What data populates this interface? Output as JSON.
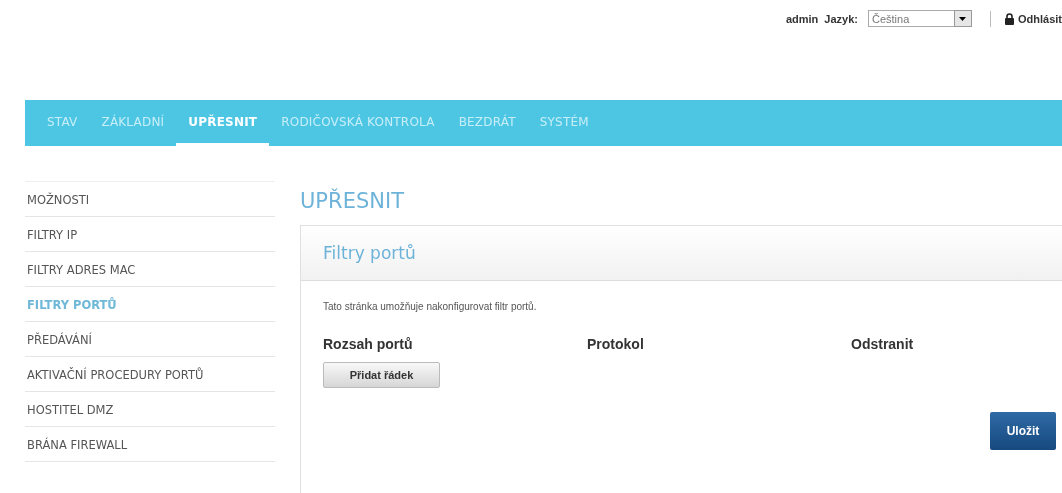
{
  "header": {
    "user": "admin",
    "language_label": "Jazyk:",
    "language_value": "Čeština",
    "logout": "Odhlásit"
  },
  "nav": [
    {
      "label": "STAV",
      "selected": false
    },
    {
      "label": "ZÁKLADNÍ",
      "selected": false
    },
    {
      "label": "UPŘESNIT",
      "selected": true
    },
    {
      "label": "RODIČOVSKÁ KONTROLA",
      "selected": false
    },
    {
      "label": "BEZDRÁT",
      "selected": false
    },
    {
      "label": "SYSTÉM",
      "selected": false
    }
  ],
  "sidebar": {
    "items": [
      {
        "label": "MOŽNOSTI",
        "selected": false
      },
      {
        "label": "FILTRY IP",
        "selected": false
      },
      {
        "label": "FILTRY ADRES MAC",
        "selected": false
      },
      {
        "label": "FILTRY PORTŮ",
        "selected": true
      },
      {
        "label": "PŘEDÁVÁNÍ",
        "selected": false
      },
      {
        "label": "AKTIVAČNÍ PROCEDURY PORTŮ",
        "selected": false
      },
      {
        "label": "HOSTITEL DMZ",
        "selected": false
      },
      {
        "label": "BRÁNA FIREWALL",
        "selected": false
      }
    ]
  },
  "page_title": "UPŘESNIT",
  "panel": {
    "title": "Filtry portů",
    "description": "Tato stránka umožňuje nakonfigurovat filtr portů.",
    "columns": [
      "Rozsah portů",
      "Protokol",
      "Odstranit"
    ],
    "add_button": "Přidat řádek",
    "save_button": "Uložit"
  }
}
